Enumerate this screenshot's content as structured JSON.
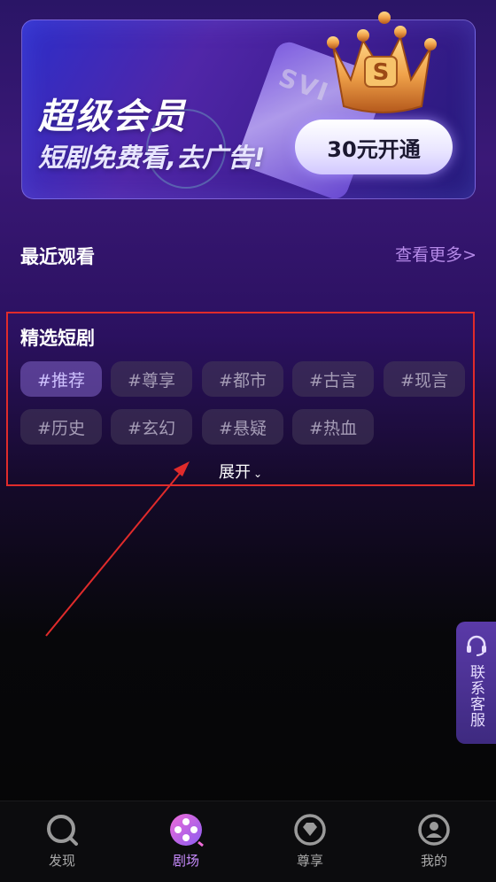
{
  "banner": {
    "title": "超级会员",
    "subtitle": "短剧免费看,去广告!",
    "button_label": "30元开通",
    "card_text": "SVI"
  },
  "recent": {
    "title": "最近观看",
    "see_more": "查看更多>"
  },
  "featured": {
    "title": "精选短剧",
    "tags": [
      "#推荐",
      "#尊享",
      "#都市",
      "#古言",
      "#现言",
      "#历史",
      "#玄幻",
      "#悬疑",
      "#热血"
    ],
    "active_tag": "#推荐",
    "expand_label": "展开"
  },
  "customer_service": {
    "label": "联系客服",
    "icon": "headset-icon"
  },
  "bottom_nav": {
    "items": [
      {
        "label": "发现",
        "icon": "discover-icon"
      },
      {
        "label": "剧场",
        "icon": "theater-icon"
      },
      {
        "label": "尊享",
        "icon": "diamond-icon"
      },
      {
        "label": "我的",
        "icon": "profile-icon"
      }
    ],
    "active": "剧场"
  },
  "colors": {
    "accent": "#c98cff",
    "see_more": "#b58ae8",
    "annotation": "#e02b2b"
  }
}
